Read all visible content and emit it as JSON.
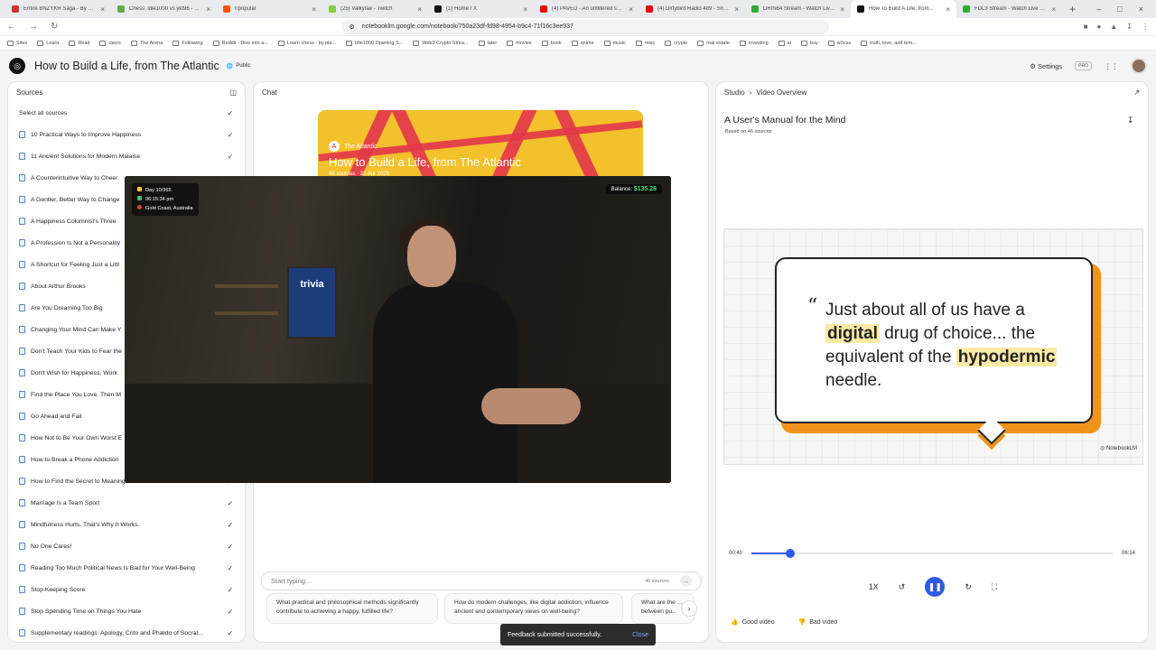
{
  "browser": {
    "tabs": [
      {
        "title": "Entire BNZYKR Saga - By Keanu Re...",
        "color": "#c33"
      },
      {
        "title": "Chess: idle1000 vs ykt96 - 882880...",
        "color": "#6a4"
      },
      {
        "title": "r/popular",
        "color": "#f50"
      },
      {
        "title": "(25) Valkyrae - Twitch",
        "color": "#8c4"
      },
      {
        "title": "(1) Home / X",
        "color": "#111"
      },
      {
        "title": "(4) PAVED - An unfiltered snowbo...",
        "color": "#e00"
      },
      {
        "title": "(4) Dirtybird Radio 489 - Sharin...",
        "color": "#e00"
      },
      {
        "title": "DRIN64 Stream - Watch Live on...",
        "color": "#3a3"
      },
      {
        "title": "How To Build A Life, from...",
        "color": "#111",
        "active": true
      },
      {
        "title": "FDL3 Stream - Watch Live on c...",
        "color": "#3a3"
      }
    ],
    "url": "notebooklm.google.com/notebook/750a23df-fd98-4954-b9c4-71f16c3ee937",
    "bookmarks": [
      "Sites",
      "Learn",
      "Read",
      "users",
      "The Arena",
      "Following",
      "Reddit - Dive into a...",
      "Learn chess - by pla...",
      "Idle1000 Opening S...",
      "Web3 Crypto Strea...",
      "later",
      "movies",
      "book",
      "anime",
      "music",
      "misc",
      "crypto",
      "real estate",
      "investing",
      "ai",
      "buy",
      "w3css",
      "truth, love, and tem..."
    ]
  },
  "app": {
    "title": "How to Build a Life, from The Atlantic",
    "visibility": "Public",
    "settings_label": "Settings",
    "pro_label": "PRO"
  },
  "sources": {
    "header": "Sources",
    "select_all": "Select all sources",
    "items": [
      "10 Practical Ways to Improve Happiness",
      "11 Ancient Solutions for Modern Malaise",
      "A Counterintuitive Way to Cheer",
      "A Gentler, Better Way to Change",
      "A Happiness Columnist's Three",
      "A Profession Is Not a Personality",
      "A Shortcut for Feeling Just a Littl",
      "About Arthur Brooks",
      "Are You Dreaming Too Big",
      "Changing Your Mind Can Make Y",
      "Don't Teach Your Kids to Fear the",
      "Don't Wish for Happiness. Work",
      "Find the Place You Love. Then M",
      "Go Ahead and Fail",
      "How Not to Be Your Own Worst E",
      "How to Break a Phone Addiction",
      "How to Find the Secret to Meaningful Work",
      "Marriage Is a Team Sport",
      "Mindfulness Hurts. That's Why It Works.",
      "No One Cares!",
      "Reading Too Much Political News Is Bad for Your Well-Being",
      "Stop Keeping Score",
      "Stop Spending Time on Things You Hate",
      "Supplementary readings: Apology, Crito and Phædo of Socrat..."
    ]
  },
  "chat": {
    "header": "Chat",
    "publisher": "The Atlantic",
    "notebook_title": "How to Build a Life, from The Atlantic",
    "meta": "46 sources · 22 Apr 2025",
    "input_placeholder": "Start typing...",
    "source_count": "46 sources",
    "suggestions": [
      "What practical and philosophical methods significantly contribute to achieving a happy, fulfilled life?",
      "How do modern challenges, like digital addiction, influence ancient and contemporary views on well-being?",
      "What are the ... between pu..."
    ]
  },
  "studio": {
    "breadcrumb_root": "Studio",
    "breadcrumb_current": "Video Overview",
    "video_title": "A User's Manual for the Mind",
    "video_sub": "Based on 46 sources",
    "quote": {
      "p1": "Just about all of us have a ",
      "h1": "digital",
      "p2": " drug of choice... the equivalent of the ",
      "h2": "hypodermic",
      "p3": " needle."
    },
    "brand": "NotebookLM",
    "time_current": "00:40",
    "time_total": "06:14",
    "progress_fraction": 0.107,
    "speed": "1X",
    "good_label": "Good video",
    "bad_label": "Bad video"
  },
  "overlay": {
    "day": "Day 10/365",
    "time": "06:15:34 pm",
    "location": "Gold Coast, Australia",
    "balance_label": "Balance:",
    "balance_value": "$135.28",
    "sign_text": "trivia"
  },
  "toast": {
    "message": "Feedback submitted successfully.",
    "close": "Close"
  }
}
